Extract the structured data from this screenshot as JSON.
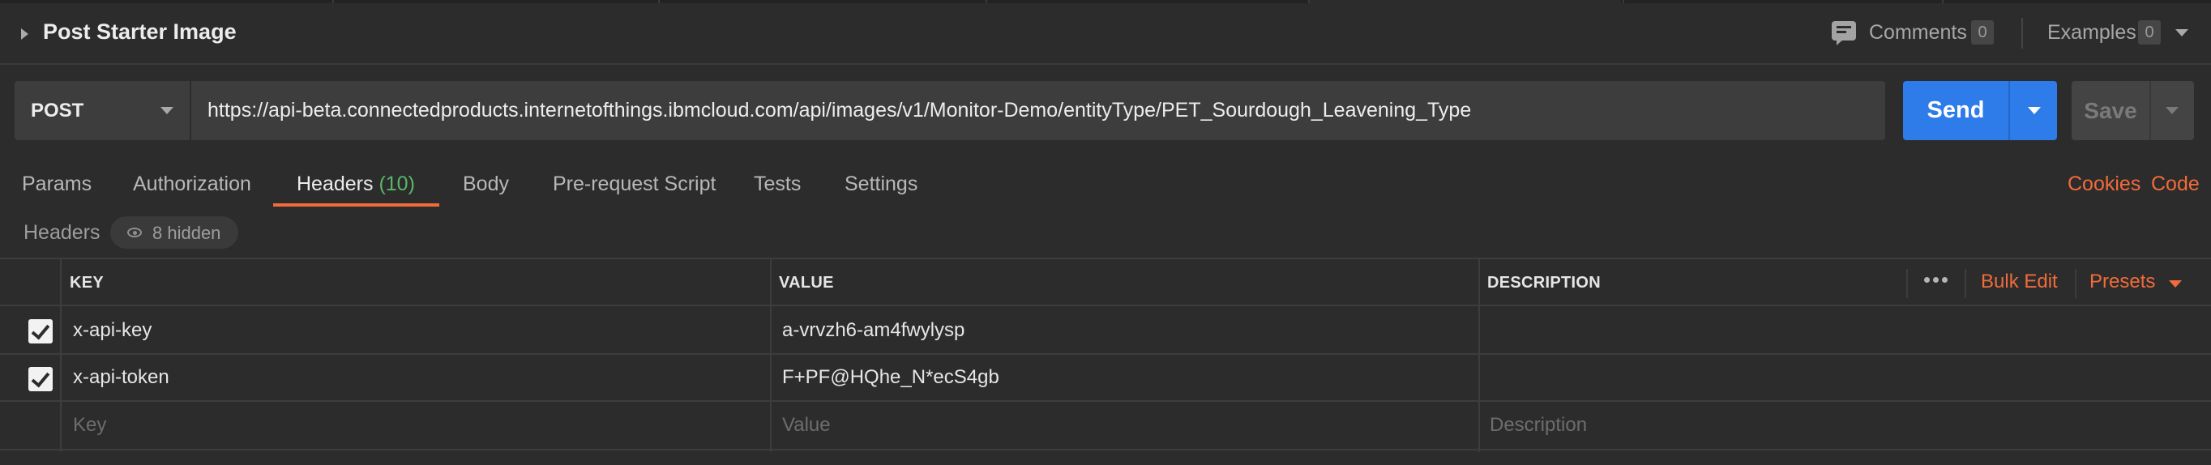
{
  "request": {
    "title": "Post Starter Image"
  },
  "header_actions": {
    "comments_label": "Comments",
    "comments_count": "0",
    "examples_label": "Examples",
    "examples_count": "0"
  },
  "url_bar": {
    "method": "POST",
    "url": "https://api-beta.connectedproducts.internetofthings.ibmcloud.com/api/images/v1/Monitor-Demo/entityType/PET_Sourdough_Leavening_Type",
    "send_label": "Send",
    "save_label": "Save"
  },
  "tabs": [
    {
      "label": "Params"
    },
    {
      "label": "Authorization"
    },
    {
      "label": "Headers",
      "count": "(10)"
    },
    {
      "label": "Body"
    },
    {
      "label": "Pre-request Script"
    },
    {
      "label": "Tests"
    },
    {
      "label": "Settings"
    }
  ],
  "right_links": {
    "cookies": "Cookies",
    "code": "Code"
  },
  "headers_section": {
    "label": "Headers",
    "hidden_label": "8 hidden"
  },
  "table": {
    "columns": {
      "key": "KEY",
      "value": "VALUE",
      "description": "DESCRIPTION"
    },
    "bulk_edit": "Bulk Edit",
    "presets": "Presets",
    "rows": [
      {
        "checked": true,
        "key": "x-api-key",
        "value": "a-vrvzh6-am4fwylysp",
        "description": ""
      },
      {
        "checked": true,
        "key": "x-api-token",
        "value": "F+PF@HQhe_N*ecS4gb",
        "description": ""
      }
    ],
    "placeholders": {
      "key": "Key",
      "value": "Value",
      "description": "Description"
    }
  },
  "colors": {
    "accent": "#f26b3a",
    "send": "#2e7bea",
    "count_green": "#5ab66a"
  }
}
